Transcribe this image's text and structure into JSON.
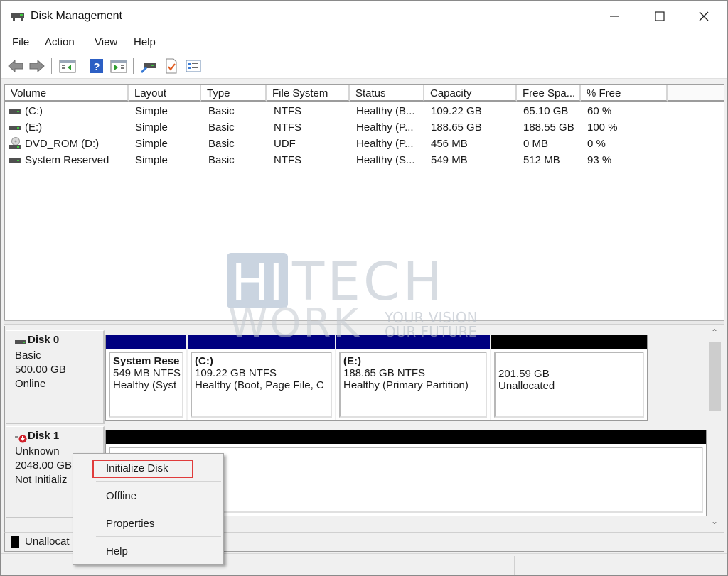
{
  "window": {
    "title": "Disk Management",
    "controls": {
      "minimize": "minimize",
      "maximize": "maximize",
      "close": "close"
    }
  },
  "menubar": [
    "File",
    "Action",
    "View",
    "Help"
  ],
  "toolbar": {
    "buttons": [
      "back",
      "forward",
      "show-hide-console-tree",
      "help",
      "show-hide-action-pane",
      "rescan-disks",
      "properties-checklist",
      "settings-list"
    ]
  },
  "volume_list": {
    "columns": [
      "Volume",
      "Layout",
      "Type",
      "File System",
      "Status",
      "Capacity",
      "Free Spa...",
      "% Free"
    ],
    "rows": [
      {
        "icon": "drive-icon",
        "volume": " (C:)",
        "layout": "Simple",
        "type": "Basic",
        "fs": "NTFS",
        "status": "Healthy (B...",
        "capacity": "109.22 GB",
        "free": "65.10 GB",
        "pct": "60 %"
      },
      {
        "icon": "drive-icon",
        "volume": " (E:)",
        "layout": "Simple",
        "type": "Basic",
        "fs": "NTFS",
        "status": "Healthy (P...",
        "capacity": "188.65 GB",
        "free": "188.55 GB",
        "pct": "100 %"
      },
      {
        "icon": "dvd-drive-icon",
        "volume": "DVD_ROM (D:)",
        "layout": "Simple",
        "type": "Basic",
        "fs": "UDF",
        "status": "Healthy (P...",
        "capacity": "456 MB",
        "free": "0 MB",
        "pct": "0 %"
      },
      {
        "icon": "drive-icon",
        "volume": "System Reserved",
        "layout": "Simple",
        "type": "Basic",
        "fs": "NTFS",
        "status": "Healthy (S...",
        "capacity": "549 MB",
        "free": "512 MB",
        "pct": "93 %"
      }
    ]
  },
  "disks": [
    {
      "name": "Disk 0",
      "type": "Basic",
      "size": "500.00 GB",
      "state": "Online",
      "partitions": [
        {
          "title": "System Rese",
          "line1": "549 MB NTFS",
          "line2": "Healthy (Syst",
          "kind": "primary"
        },
        {
          "title": " (C:)",
          "line1": "109.22 GB NTFS",
          "line2": "Healthy (Boot, Page File, C",
          "kind": "primary"
        },
        {
          "title": " (E:)",
          "line1": "188.65 GB NTFS",
          "line2": "Healthy (Primary Partition)",
          "kind": "primary"
        },
        {
          "title": "",
          "line1": "201.59 GB",
          "line2": "Unallocated",
          "kind": "unallocated"
        }
      ]
    },
    {
      "name": "Disk 1",
      "type": "Unknown",
      "size": "2048.00 GB",
      "state": "Not Initializ",
      "partitions": [
        {
          "title": "",
          "line1": "",
          "line2": "",
          "kind": "unallocated"
        }
      ]
    }
  ],
  "legend": [
    {
      "label": "Unallocat",
      "color": "#000000"
    }
  ],
  "colors": {
    "primary_partition": "#000080",
    "unallocated": "#000000",
    "highlight": "#e03c3c"
  },
  "context_menu": {
    "items": [
      "Initialize Disk",
      "Offline",
      "Properties",
      "Help"
    ],
    "highlighted": "Initialize Disk"
  },
  "watermark": {
    "line1": "HITECH",
    "line2": "WORK",
    "tagline1": "YOUR VISION",
    "tagline2": "OUR FUTURE"
  }
}
